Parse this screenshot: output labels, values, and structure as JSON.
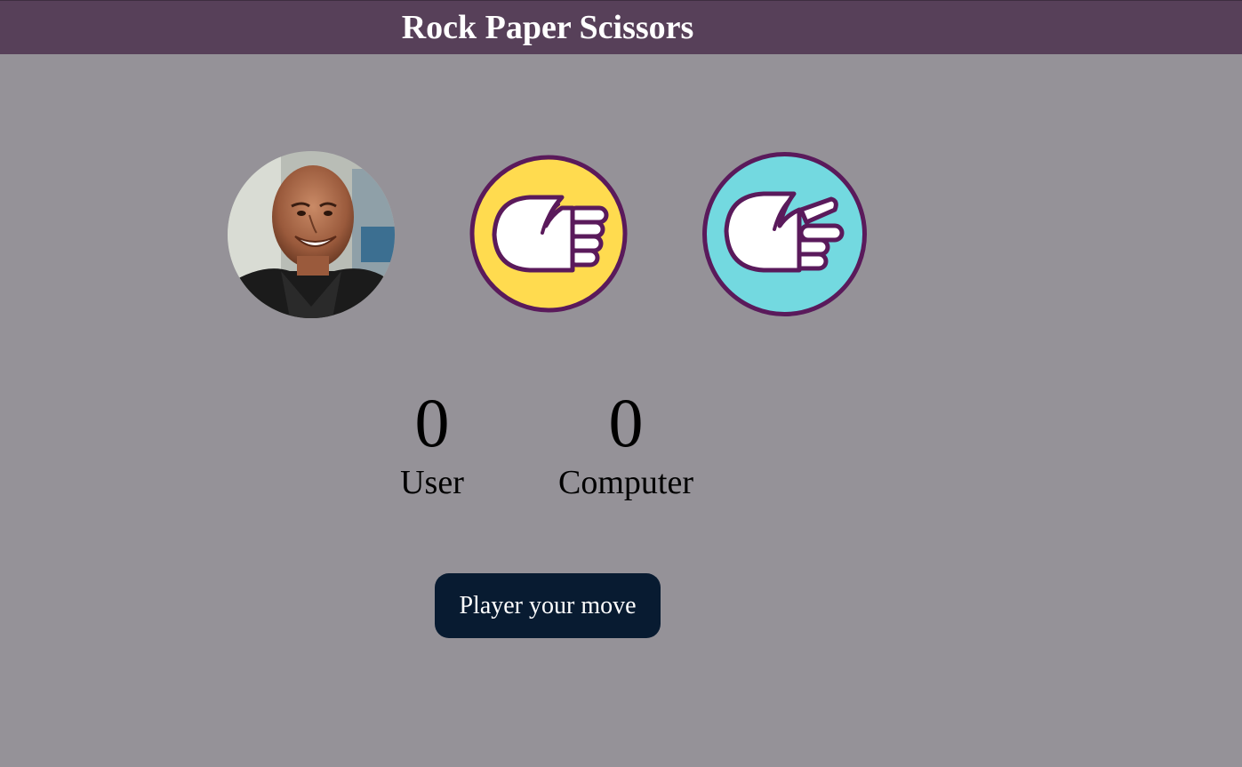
{
  "header": {
    "title": "Rock Paper Scissors"
  },
  "choices": [
    {
      "id": "rock",
      "icon": "rock-face-photo"
    },
    {
      "id": "paper",
      "icon": "paper-hand-icon",
      "bg": "#ffdb4f"
    },
    {
      "id": "scissors",
      "icon": "scissors-hand-icon",
      "bg": "#73d9e0"
    }
  ],
  "scoreboard": {
    "user_score": "0",
    "user_label": "User",
    "computer_score": "0",
    "computer_label": "Computer"
  },
  "message": "Player your move",
  "colors": {
    "background": "#959298",
    "header": "#574059",
    "icon_outline": "#5a1a5b",
    "message_bg": "#081b31"
  }
}
